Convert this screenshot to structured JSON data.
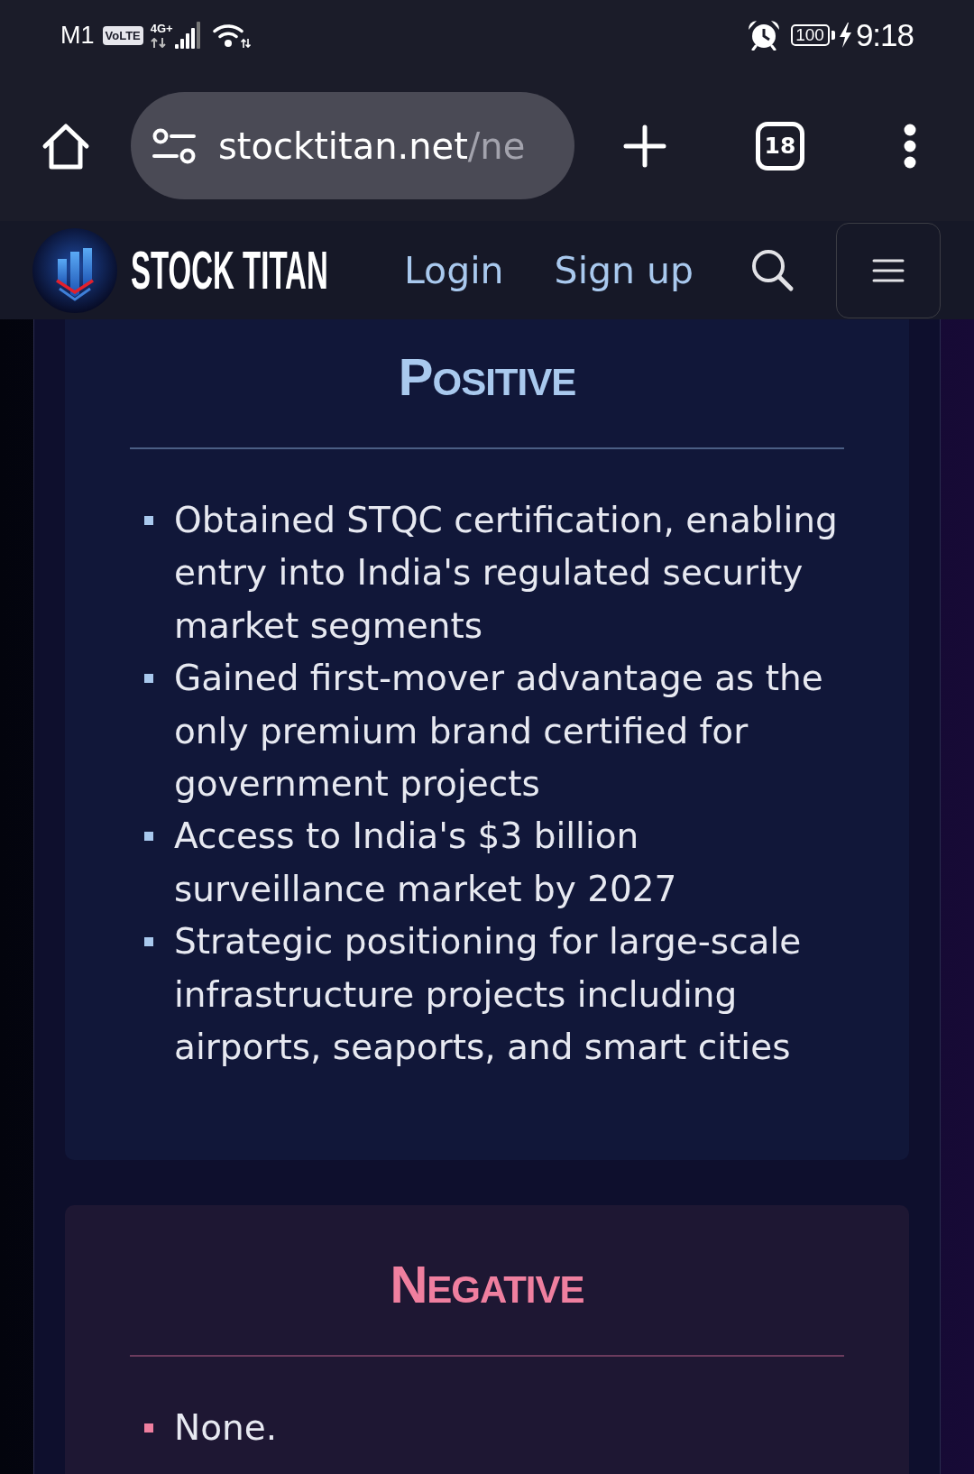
{
  "status_bar": {
    "carrier": "M1",
    "volte": "VoLTE",
    "network": "4G+",
    "battery": "100",
    "time": "9:18"
  },
  "browser_toolbar": {
    "url_host": "stocktitan.net",
    "url_path": "/ne",
    "tab_count": "18"
  },
  "site_header": {
    "brand": "STOCK TITAN",
    "links": [
      "Login",
      "Sign up"
    ]
  },
  "sections": [
    {
      "kind": "positive",
      "title": "POSITIVE",
      "items": [
        "Obtained STQC certification, enabling entry into India's regulated security market segments",
        "Gained first-mover advantage as the only premium brand certified for government projects",
        "Access to India's $3 billion surveillance market by 2027",
        "Strategic positioning for large-scale infrastructure projects including airports, seaports, and smart cities"
      ]
    },
    {
      "kind": "negative",
      "title": "NEGATIVE",
      "items": [
        "None."
      ]
    }
  ]
}
